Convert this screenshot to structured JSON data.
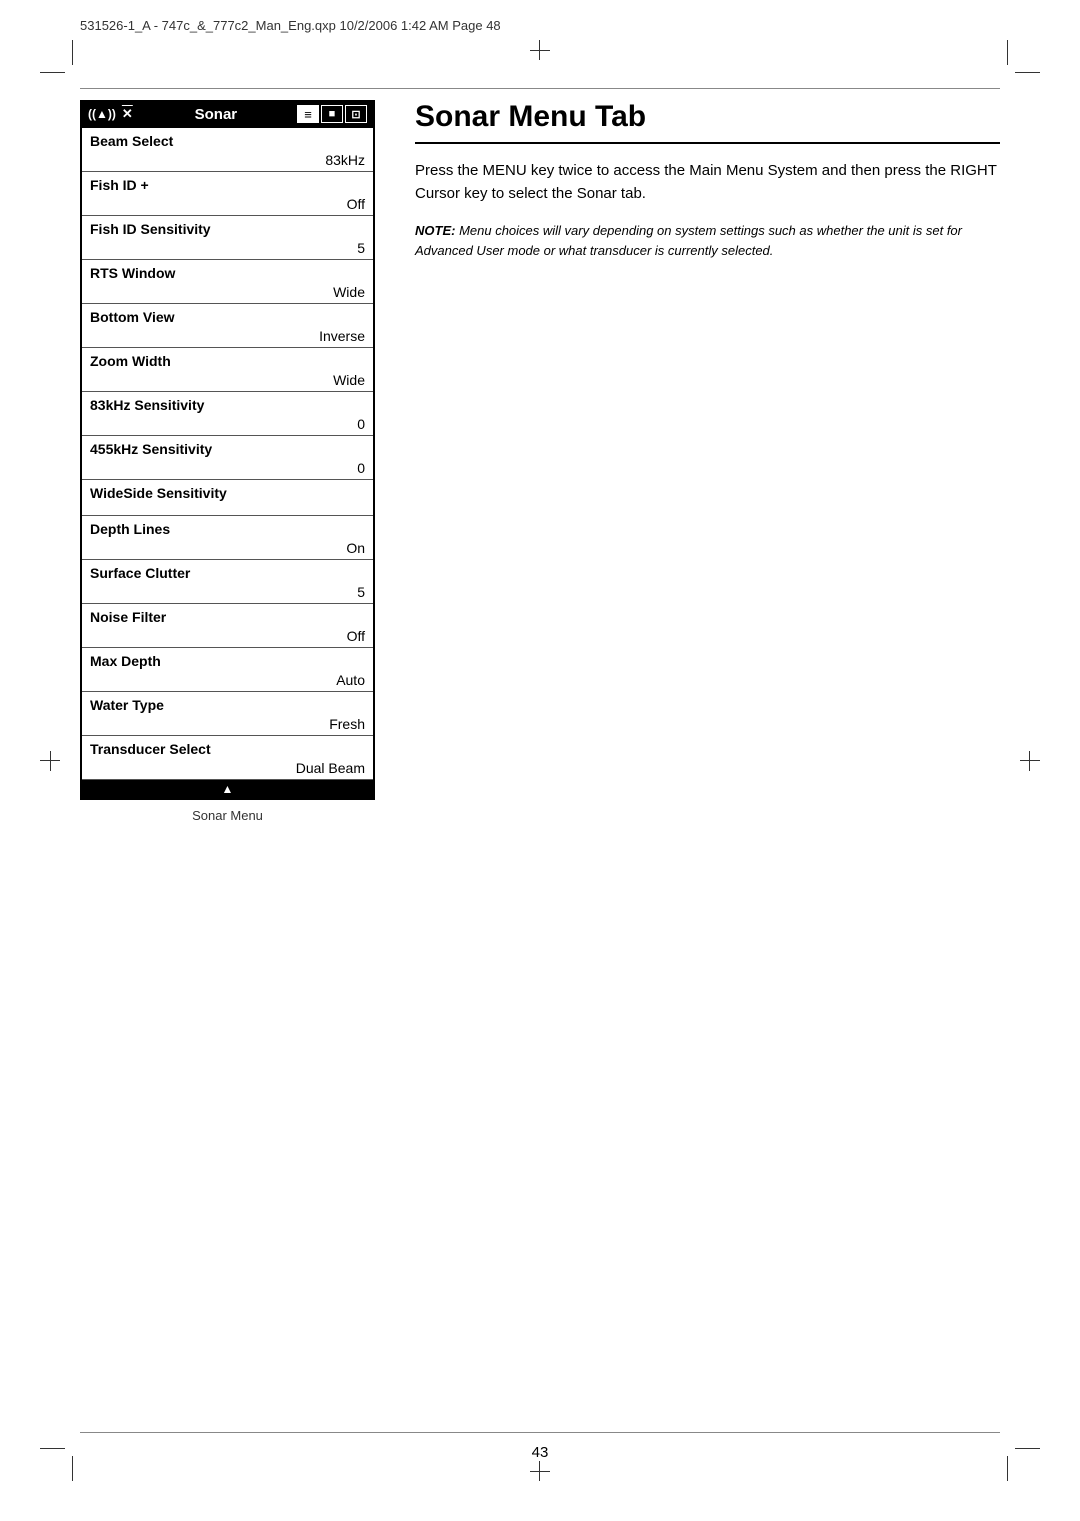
{
  "header": {
    "text": "531526-1_A - 747c_&_777c2_Man_Eng.qxp   10/2/2006   1:42 AM   Page 48"
  },
  "left_panel": {
    "menu_header": {
      "icon_left": "((▲))",
      "title": "Sonar",
      "icons": [
        "≡",
        "■",
        "□"
      ]
    },
    "menu_items": [
      {
        "label": "Beam Select",
        "value": "83kHz"
      },
      {
        "label": "Fish ID +",
        "value": "Off"
      },
      {
        "label": "Fish ID Sensitivity",
        "value": "5"
      },
      {
        "label": "RTS Window",
        "value": "Wide"
      },
      {
        "label": "Bottom View",
        "value": "Inverse"
      },
      {
        "label": "Zoom Width",
        "value": "Wide"
      },
      {
        "label": "83kHz Sensitivity",
        "value": "0"
      },
      {
        "label": "455kHz Sensitivity",
        "value": "0"
      },
      {
        "label": "WideSide Sensitivity",
        "value": ""
      },
      {
        "label": "Depth Lines",
        "value": "On"
      },
      {
        "label": "Surface Clutter",
        "value": "5"
      },
      {
        "label": "Noise Filter",
        "value": "Off"
      },
      {
        "label": "Max Depth",
        "value": "Auto"
      },
      {
        "label": "Water Type",
        "value": "Fresh"
      },
      {
        "label": "Transducer Select",
        "value": "Dual Beam"
      }
    ],
    "scroll_indicator": "▲",
    "caption": "Sonar Menu"
  },
  "right_panel": {
    "title": "Sonar Menu Tab",
    "description": "Press the MENU key twice to access the Main Menu System and then press the RIGHT Cursor key to select the Sonar tab.",
    "note_label": "NOTE:",
    "note_text": " Menu choices will vary depending on system settings such as whether the unit is set for Advanced User mode or what transducer is currently selected."
  },
  "page_number": "43"
}
